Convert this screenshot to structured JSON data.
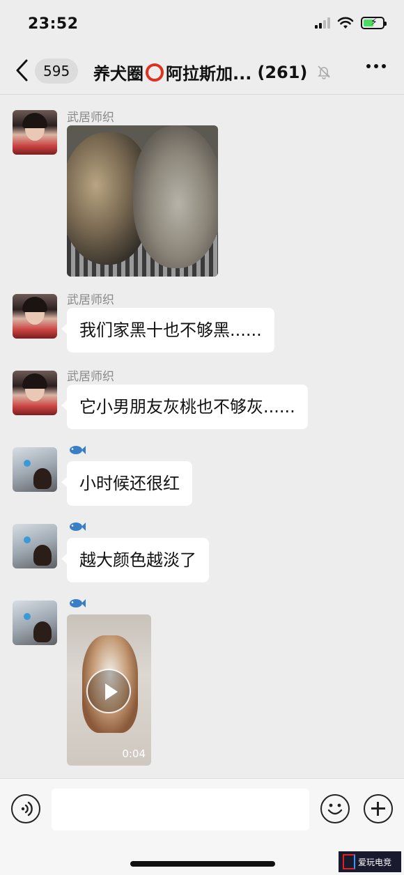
{
  "status_bar": {
    "time": "23:52"
  },
  "nav": {
    "unread_count": "595",
    "title_part1": "养犬圈",
    "title_part2": "阿拉斯加...",
    "member_count": "(261)"
  },
  "messages": [
    {
      "sender": "武居师织",
      "type": "image"
    },
    {
      "sender": "武居师织",
      "type": "text",
      "text": "我们家黑十也不够黑......"
    },
    {
      "sender": "武居师织",
      "type": "text",
      "text": "它小男朋友灰桃也不够灰......"
    },
    {
      "sender_icon": "fish-icon",
      "type": "text",
      "text": "小时候还很红"
    },
    {
      "sender_icon": "fish-icon",
      "type": "text",
      "text": "越大颜色越淡了"
    },
    {
      "sender_icon": "fish-icon",
      "type": "video",
      "duration": "0:04"
    }
  ],
  "watermark": {
    "text": "爱玩电竞"
  },
  "colors": {
    "background": "#ededed",
    "bubble": "#ffffff",
    "ring": "#e0301e",
    "battery": "#4cd964"
  }
}
